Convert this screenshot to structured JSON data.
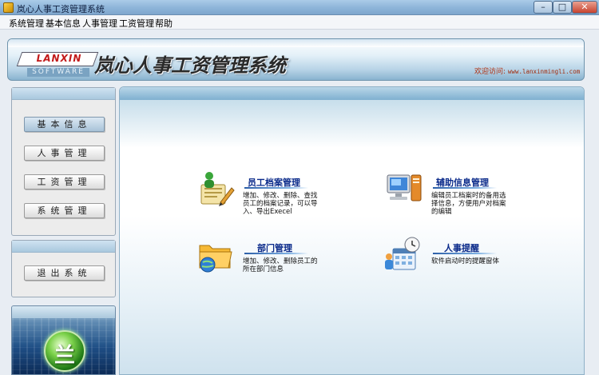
{
  "window": {
    "title": "岚心人事工资管理系统",
    "controls": {
      "minimize": "–",
      "maximize": "□",
      "close": "✕"
    }
  },
  "menu": [
    "系统管理",
    "基本信息",
    "人事管理",
    "工资管理",
    "帮助"
  ],
  "banner": {
    "logo_text": "LANXIN",
    "logo_sub": "SOFTWARE",
    "app_title": "岚心人事工资管理系统",
    "visit_label": "欢迎访问:",
    "visit_url": "www.lanxinmingli.com"
  },
  "sidebar": {
    "buttons": [
      "基本信息",
      "人事管理",
      "工资管理",
      "系统管理"
    ],
    "exit_button": "退出系统",
    "emblem_char": "兰"
  },
  "features": [
    {
      "title": "员工档案管理",
      "desc": "增加、修改、删除、查找员工的档案记录，可以导入、导出Execel",
      "icon": "employee-records-icon"
    },
    {
      "title": "辅助信息管理",
      "desc": "编辑员工档案时的备用选择信息，方便用户对档案的编辑",
      "icon": "computer-icon"
    },
    {
      "title": "部门管理",
      "desc": "增加、修改、删除员工的所在部门信息",
      "icon": "folder-globe-icon"
    },
    {
      "title": "人事提醒",
      "desc": "软件启动时的提醒窗体",
      "icon": "calendar-clock-icon"
    }
  ],
  "colors": {
    "title_bar": "#8fb6da",
    "feature_title": "#0a2a8a",
    "visit_text": "#b03010",
    "logo_red": "#c21a1a"
  }
}
